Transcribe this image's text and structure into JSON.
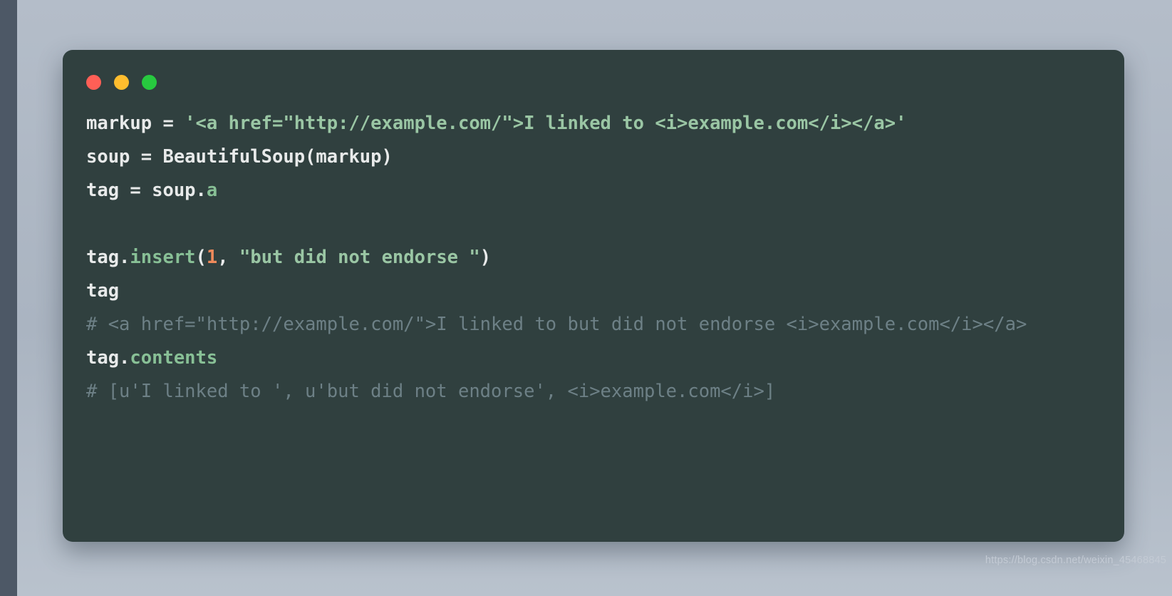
{
  "page": {
    "background_color": "#aeb7c4",
    "left_edge_color": "#4d5866",
    "watermark": "https://blog.csdn.net/weixin_45468845"
  },
  "code_window": {
    "background_color": "#30403f",
    "traffic_lights": [
      {
        "name": "close",
        "color": "#ff5f56"
      },
      {
        "name": "minimize",
        "color": "#ffbd2e"
      },
      {
        "name": "maximize",
        "color": "#27c93f"
      }
    ],
    "palette": {
      "plain": "#e8eaea",
      "string": "#9ac6a4",
      "attribute": "#88c096",
      "number": "#ef8a5b",
      "comment": "#6d8086"
    },
    "language": "python",
    "lines": [
      {
        "id": "line-1",
        "type": "code",
        "tokens": [
          {
            "kind": "plain",
            "text": "markup = "
          },
          {
            "kind": "string",
            "text": "'<a href=\"http://example.com/\">I linked to <i>example.com</i></a>'"
          }
        ]
      },
      {
        "id": "line-2",
        "type": "code",
        "tokens": [
          {
            "kind": "plain",
            "text": "soup = BeautifulSoup(markup)"
          }
        ]
      },
      {
        "id": "line-3",
        "type": "code",
        "tokens": [
          {
            "kind": "plain",
            "text": "tag = soup."
          },
          {
            "kind": "attribute",
            "text": "a"
          }
        ]
      },
      {
        "id": "line-4",
        "type": "blank",
        "tokens": []
      },
      {
        "id": "line-5",
        "type": "code",
        "tokens": [
          {
            "kind": "plain",
            "text": "tag."
          },
          {
            "kind": "attribute",
            "text": "insert"
          },
          {
            "kind": "plain",
            "text": "("
          },
          {
            "kind": "number",
            "text": "1"
          },
          {
            "kind": "plain",
            "text": ", "
          },
          {
            "kind": "string",
            "text": "\"but did not endorse \""
          },
          {
            "kind": "plain",
            "text": ")"
          }
        ]
      },
      {
        "id": "line-6",
        "type": "code",
        "tokens": [
          {
            "kind": "plain",
            "text": "tag"
          }
        ]
      },
      {
        "id": "line-7",
        "type": "comment",
        "tokens": [
          {
            "kind": "comment",
            "text": "# <a href=\"http://example.com/\">I linked to but did not endorse <i>example.com</i></a>"
          }
        ]
      },
      {
        "id": "line-8",
        "type": "code",
        "tokens": [
          {
            "kind": "plain",
            "text": "tag."
          },
          {
            "kind": "attribute",
            "text": "contents"
          }
        ]
      },
      {
        "id": "line-9",
        "type": "comment",
        "tokens": [
          {
            "kind": "comment",
            "text": "# [u'I linked to ', u'but did not endorse', <i>example.com</i>]"
          }
        ]
      }
    ]
  }
}
